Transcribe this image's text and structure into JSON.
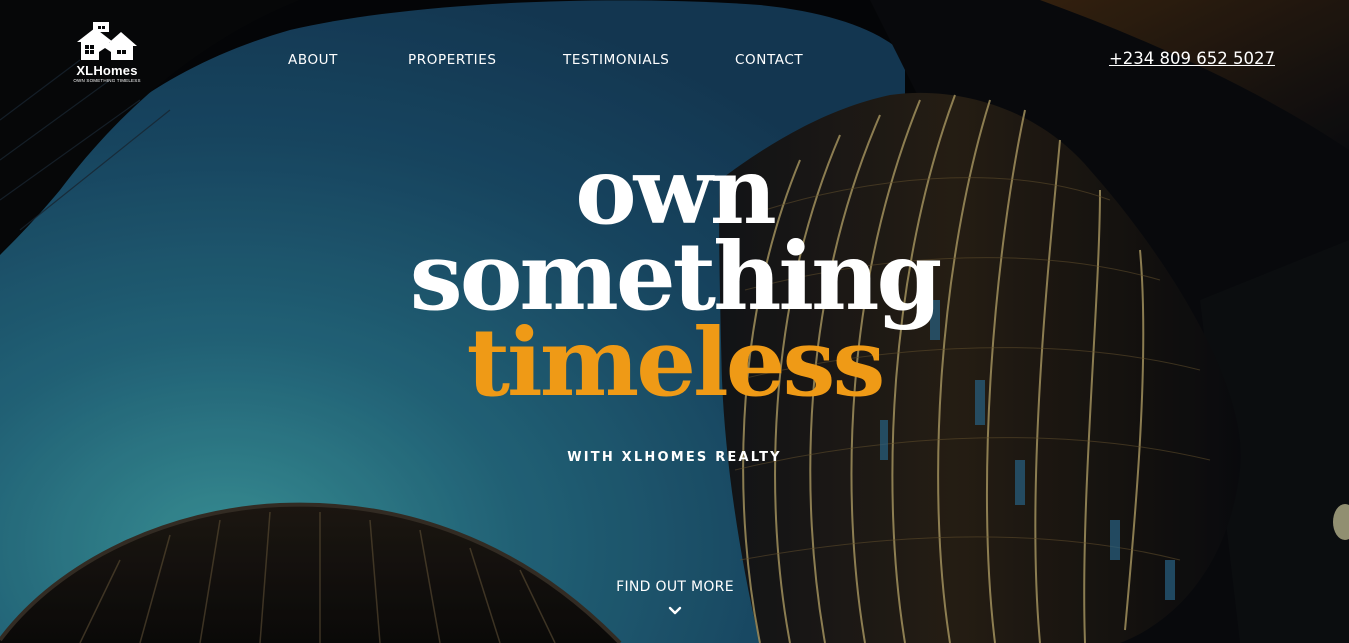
{
  "brand": {
    "name": "XLHomes",
    "tagline": "OWN SOMETHING TIMELESS"
  },
  "nav": {
    "items": [
      {
        "label": "ABOUT"
      },
      {
        "label": "PROPERTIES"
      },
      {
        "label": "TESTIMONIALS"
      },
      {
        "label": "CONTACT"
      }
    ]
  },
  "header": {
    "phone": "+234 809 652 5027"
  },
  "hero": {
    "line1": "own",
    "line2": "something",
    "line3": "timeless",
    "subline": "WITH XLHOMES REALTY",
    "cta_label": "FIND OUT MORE",
    "cta_icon": "chevron-down-icon"
  },
  "colors": {
    "accent": "#ef9a16",
    "text": "#ffffff",
    "sky": "#1c5f7a"
  }
}
